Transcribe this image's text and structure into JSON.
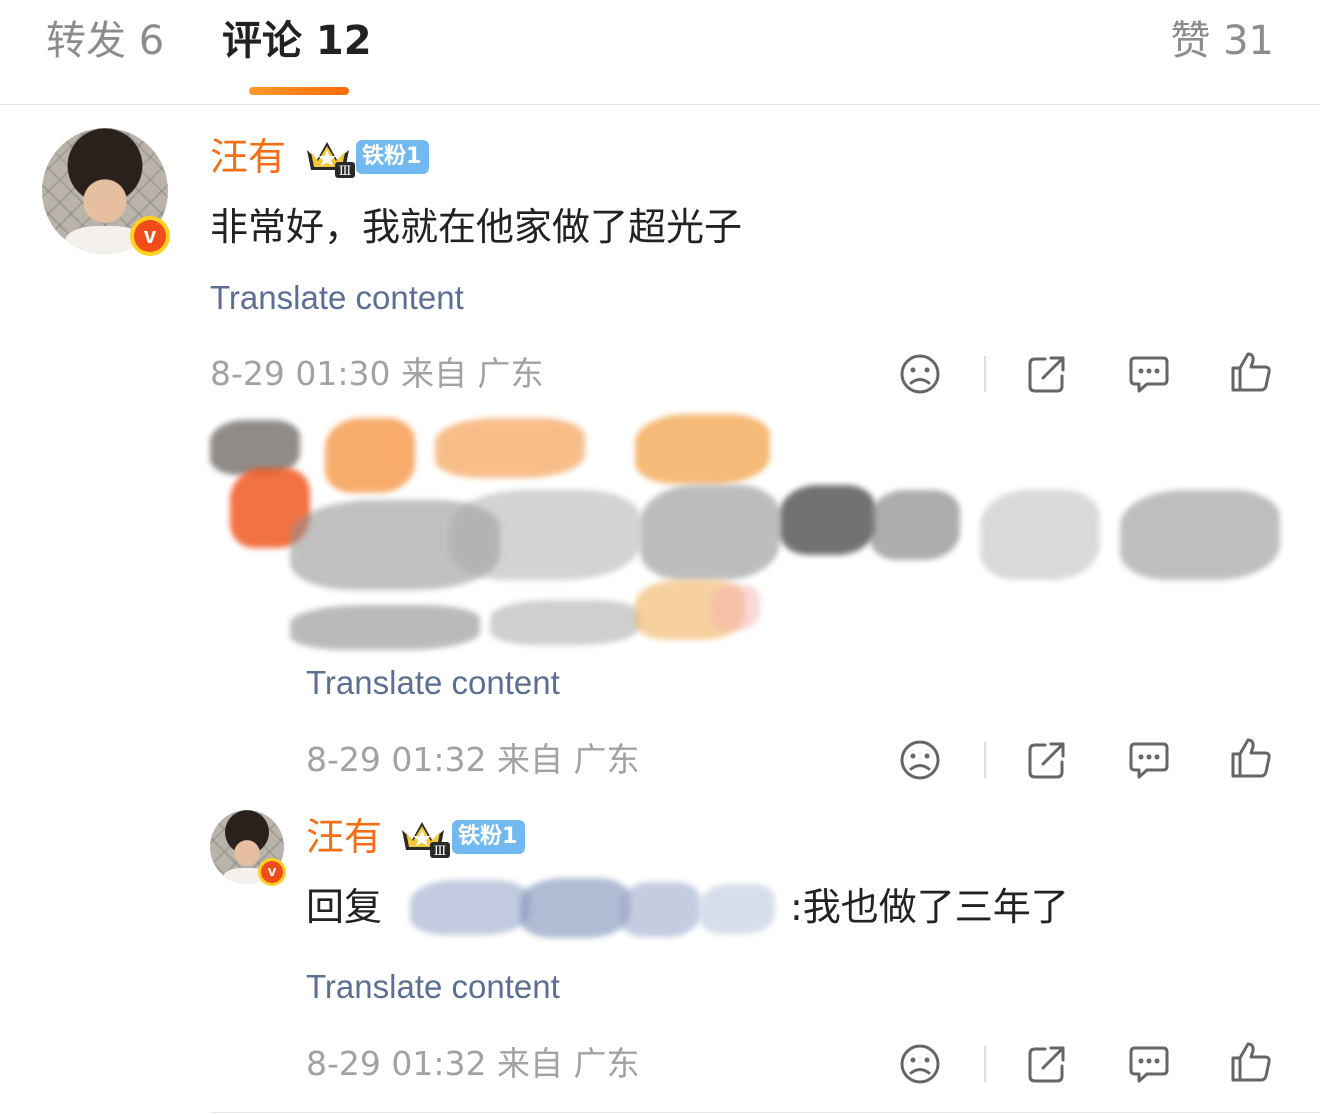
{
  "tabs": {
    "repost": "转发 6",
    "comment": "评论 12",
    "like": "赞 31"
  },
  "comments": [
    {
      "username": "汪有",
      "fan_badge": "铁粉1",
      "text": "非常好，我就在他家做了超光子",
      "translate": "Translate content",
      "meta": "8-29 01:30 来自 广东"
    },
    {
      "translate": "Translate content",
      "meta": "8-29 01:32 来自 广东"
    },
    {
      "username": "汪有",
      "fan_badge": "铁粉1",
      "reply_prefix": "回复",
      "text": ":我也做了三年了",
      "translate": "Translate content",
      "meta": "8-29 01:32 来自 广东"
    }
  ],
  "icons": {
    "dislike": "sad-face-icon",
    "share": "share-icon",
    "reply": "comment-bubble-icon",
    "like": "thumbs-up-icon"
  },
  "colors": {
    "username": "#f36e16",
    "translate_link": "#5d6e95",
    "tab_indicator": "#ff7a12",
    "fan_badge": "#72b9f2",
    "meta_text": "#a2a2a2"
  }
}
